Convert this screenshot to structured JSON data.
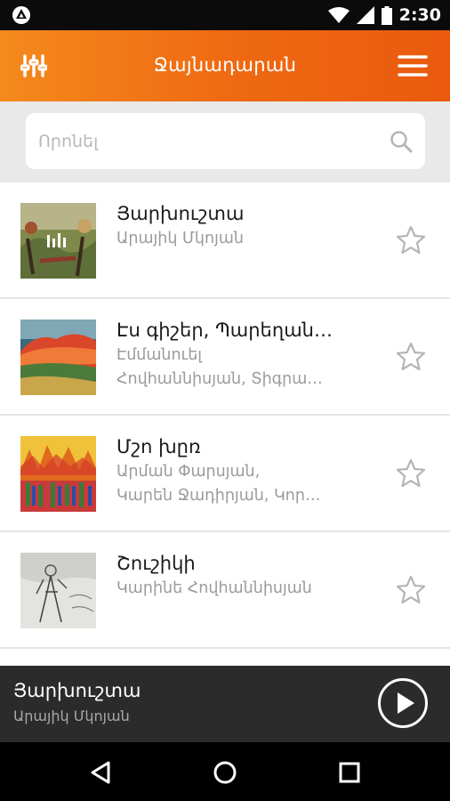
{
  "status_bar": {
    "time": "2:30",
    "icons": [
      "app-logo-icon",
      "wifi-icon",
      "signal-icon",
      "battery-icon"
    ]
  },
  "app_bar": {
    "title": "Ջայնադարան",
    "left_icon": "equalizer-icon",
    "right_icon": "hamburger-menu-icon"
  },
  "search": {
    "placeholder": "Որոնել",
    "value": ""
  },
  "songs": [
    {
      "title": "Յարխուշտա",
      "artist_line1": "Արայիկ Մկոյան",
      "artist_line2": "",
      "favorite": false
    },
    {
      "title": "Էս գիշեր, Պարեղան…",
      "artist_line1": "Էմմանուել",
      "artist_line2": "Հովհաննիսյան, Տիգրա…",
      "favorite": false
    },
    {
      "title": "Մշո խըռ",
      "artist_line1": "Արման Փարսյան,",
      "artist_line2": "Կարեն Ջադիրյան, Կոր…",
      "favorite": false
    },
    {
      "title": "Շուշիկի",
      "artist_line1": "Կարինե Հովհաննիսյան",
      "artist_line2": "",
      "favorite": false
    }
  ],
  "now_playing": {
    "title": "Յարխուշտա",
    "artist": "Արայիկ Մկոյան",
    "state": "paused"
  },
  "colors": {
    "accent_start": "#f48a1c",
    "accent_end": "#ea5a0e",
    "player_bg": "#2b2b2b"
  }
}
